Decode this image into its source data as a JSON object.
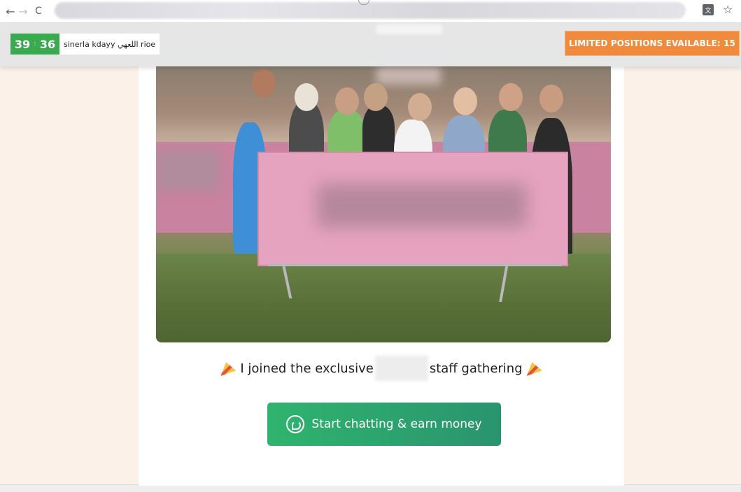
{
  "browser": {
    "back_icon": "←",
    "forward_icon": "→",
    "reload_icon": "C",
    "star_icon": "☆",
    "translate_icon": "文"
  },
  "top_bar": {
    "timer_minutes": "39",
    "timer_seconds": "36",
    "timer_separator": ":",
    "timer_label": "sinerla kdayy اللعهي rioe",
    "limited_positions_text": "LIMITED POSITIONS EVAILABLE: 15"
  },
  "caption": {
    "before": "I joined the exclusive",
    "after": "staff gathering"
  },
  "cta": {
    "label": "Start chatting & earn money"
  },
  "colors": {
    "timer_green": "#3aaa4e",
    "badge_orange": "#f08b3e",
    "cta_green_start": "#2fb46e",
    "cta_green_end": "#2a946f",
    "page_background": "#fbf1e9"
  }
}
